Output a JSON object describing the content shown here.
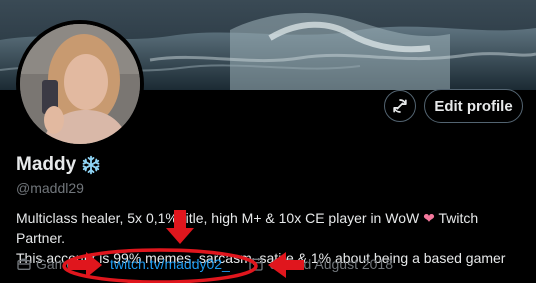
{
  "profile": {
    "name": "Maddy",
    "handle": "@maddl29",
    "bio_line1_before_heart": "Multiclass healer, 5x 0,1% title, high M+ & 10x CE player in WoW",
    "bio_heart": "❤",
    "bio_line1_after_heart": " Twitch Partner.",
    "bio_line2": "This account is 99% memes, sarcasm, satire & 1% about being a based gamer"
  },
  "actions": {
    "edit_label": "Edit profile"
  },
  "meta": {
    "category": "Gamer",
    "link": "twitch.tv/maddy02_",
    "joined": "Joined August 2018"
  },
  "icons": {
    "snowflake": "snowflake-icon",
    "refresh": "refresh-icon",
    "briefcase": "briefcase-icon",
    "calendar": "calendar-icon"
  },
  "colors": {
    "link": "#1d9bf0",
    "annotation": "#e0161d",
    "heart": "#f4789c"
  }
}
